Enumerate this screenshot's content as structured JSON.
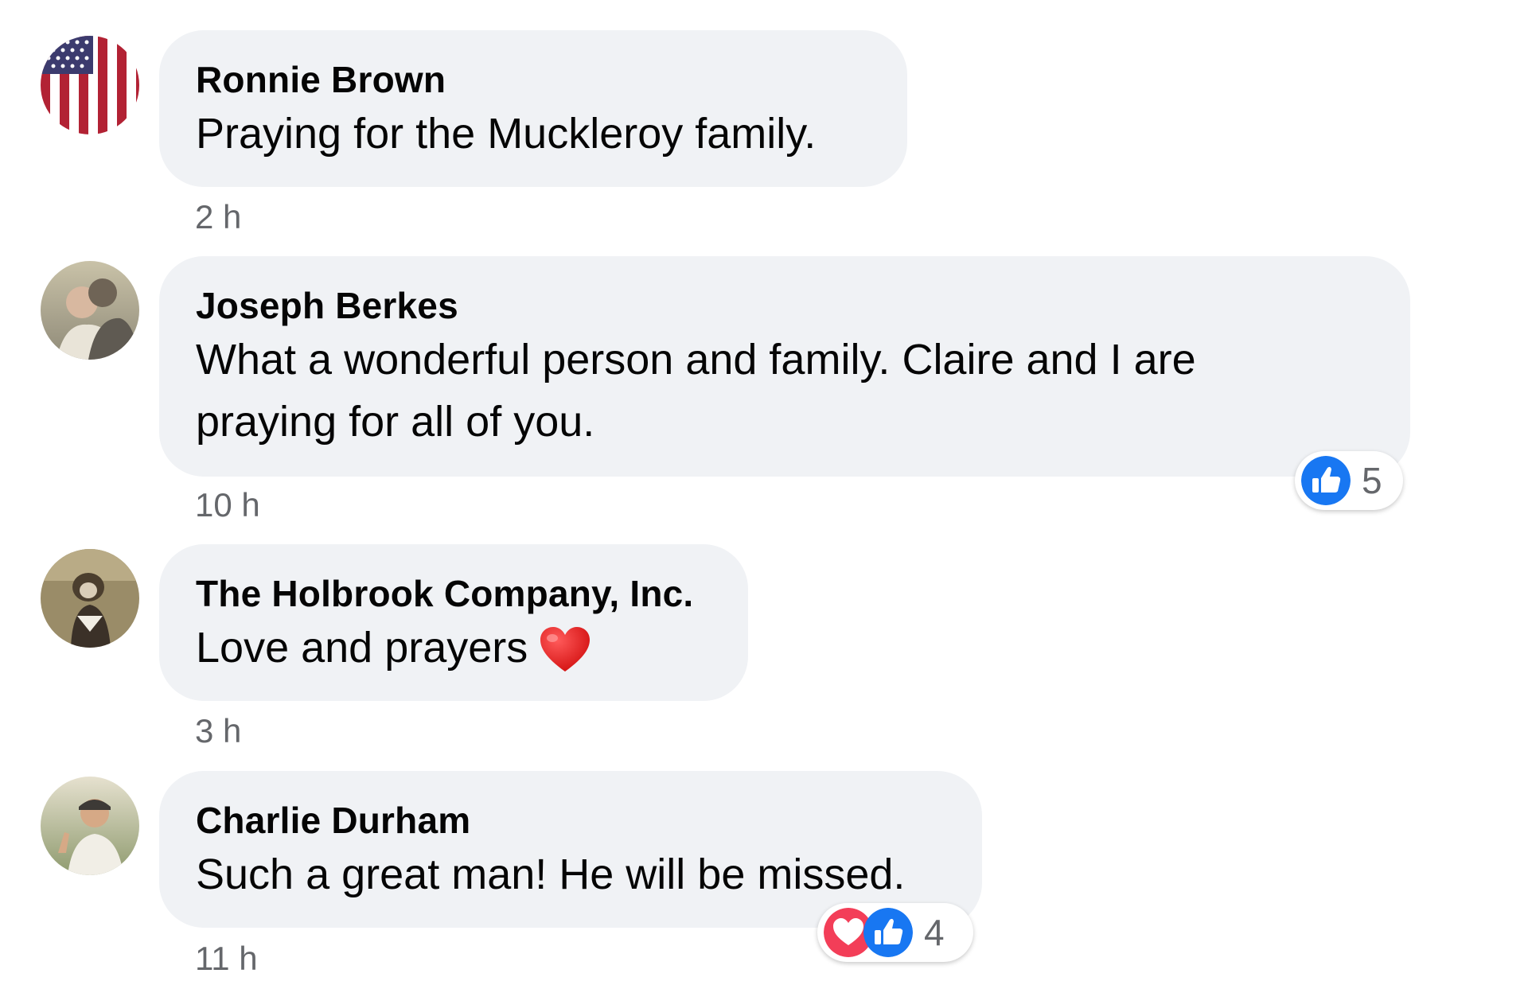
{
  "comments": [
    {
      "author": "Ronnie Brown",
      "text": "Praying for the Muckleroy family.",
      "time": "2 h",
      "avatar_icon": "american-flag-avatar"
    },
    {
      "author": "Joseph Berkes",
      "text_line1": "What a wonderful person and family. Claire and I are",
      "text_line2": "praying for all of you.",
      "time": "10 h",
      "avatar_icon": "couple-photo-avatar",
      "reactions": {
        "types": [
          "like"
        ],
        "count": "5"
      }
    },
    {
      "author": "The Holbrook Company, Inc.",
      "text": "Love and prayers",
      "emoji": "red-heart-emoji",
      "time": "3 h",
      "avatar_icon": "dog-photo-avatar"
    },
    {
      "author": "Charlie Durham",
      "text": "Such a great man! He will be missed.",
      "time": "11 h",
      "avatar_icon": "man-cap-photo-avatar",
      "reactions": {
        "types": [
          "love",
          "like"
        ],
        "count": "4"
      }
    }
  ],
  "colors": {
    "bubble": "#f0f2f5",
    "meta_text": "#65676b",
    "like_blue": "#1877f2",
    "love_red": "#f33e58"
  }
}
